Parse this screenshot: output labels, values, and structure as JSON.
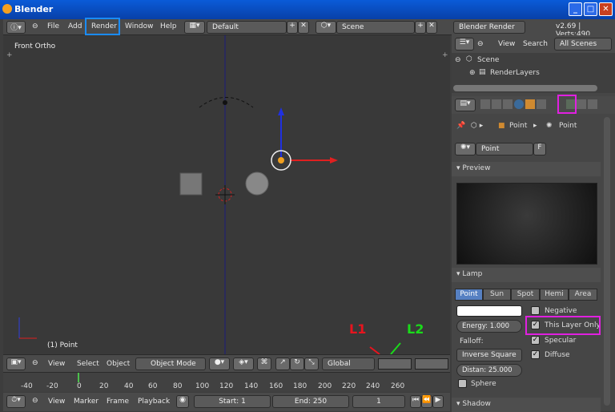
{
  "window": {
    "title": "Blender"
  },
  "topbar": {
    "menus": [
      "File",
      "Add",
      "Render",
      "Window",
      "Help"
    ],
    "layout": "Default",
    "scene": "Scene",
    "engine": "Blender Render",
    "version": "v2.69 | Verts:490"
  },
  "viewport": {
    "view_label": "Front Ortho",
    "object_label": "(1) Point",
    "mode": "Object Mode",
    "orientation": "Global",
    "menus": [
      "View",
      "Select",
      "Object"
    ],
    "l1": "L1",
    "l2": "L2"
  },
  "timeline": {
    "ticks": [
      "-40",
      "-20",
      "0",
      "20",
      "40",
      "60",
      "80",
      "100",
      "120",
      "140",
      "160",
      "180",
      "200",
      "220",
      "240",
      "260"
    ],
    "menus": [
      "View",
      "Marker",
      "Frame",
      "Playback"
    ],
    "start": "Start: 1",
    "end": "End: 250",
    "current": "1"
  },
  "outliner": {
    "view": "View",
    "search": "Search",
    "filter": "All Scenes",
    "items": [
      "Scene",
      "RenderLayers"
    ]
  },
  "properties": {
    "crumb1": "Point",
    "crumb2": "Point",
    "name": "Point",
    "fake_user": "F",
    "preview_title": "Preview",
    "lamp_title": "Lamp",
    "lamp_types": [
      "Point",
      "Sun",
      "Spot",
      "Hemi",
      "Area"
    ],
    "energy": "Energy: 1.000",
    "falloff_label": "Falloff:",
    "falloff": "Inverse Square",
    "distance": "Distan: 25.000",
    "negative": "Negative",
    "this_layer_only": "This Layer Only",
    "specular": "Specular",
    "diffuse": "Diffuse",
    "sphere": "Sphere",
    "shadow_title": "Shadow"
  },
  "colors": {
    "highlight": "#e020e0",
    "header_highlight": "#1a8cff",
    "l1": "#e8141e",
    "l2": "#1adb1a"
  }
}
